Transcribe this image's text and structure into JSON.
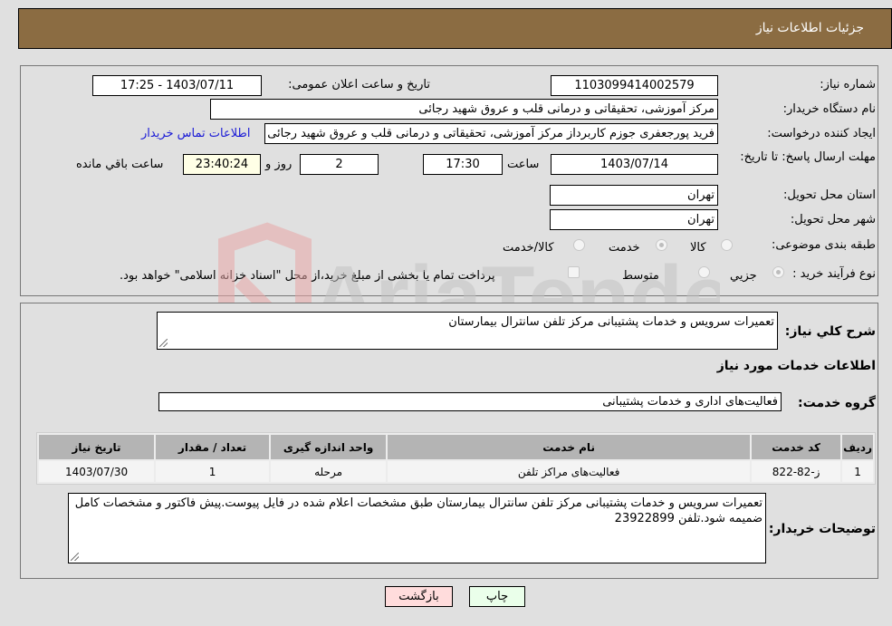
{
  "header": {
    "title": "جزئیات اطلاعات نیاز"
  },
  "fields": {
    "need_number": {
      "label": "شماره نیاز:",
      "value": "1103099414002579"
    },
    "announce_datetime": {
      "label": "تاریخ و ساعت اعلان عمومی:",
      "value": "1403/07/11 - 17:25"
    },
    "buyer_org": {
      "label": "نام دستگاه خریدار:",
      "value": "مرکز آموزشی، تحقیقاتی و درمانی قلب و عروق شهید رجائی"
    },
    "requester": {
      "label": "ایجاد کننده درخواست:",
      "value": "فرید پورجعفری جوزم کاربرداز  مرکز آموزشی، تحقیقاتی و درمانی قلب و عروق شهید رجائی",
      "contact_link": "اطلاعات تماس خریدار"
    },
    "deadline": {
      "label": "مهلت ارسال پاسخ: تا تاریخ:",
      "date": "1403/07/14",
      "time_label": "ساعت",
      "time": "17:30",
      "days": "2",
      "days_label": "روز و",
      "remaining": "23:40:24",
      "remaining_label": "ساعت باقي مانده"
    },
    "province": {
      "label": "استان محل تحویل:",
      "value": "تهران"
    },
    "city": {
      "label": "شهر محل تحویل:",
      "value": "تهران"
    },
    "category": {
      "label": "طبقه بندی موضوعی:",
      "options": [
        {
          "label": "کالا",
          "checked": false
        },
        {
          "label": "خدمت",
          "checked": true
        },
        {
          "label": "کالا/خدمت",
          "checked": false
        }
      ]
    },
    "purchase_type": {
      "label": "نوع فرآیند خرید :",
      "options": [
        {
          "label": "جزيي",
          "checked": true
        },
        {
          "label": "متوسط",
          "checked": false
        }
      ],
      "treasury_checkbox_label": "پرداخت تمام یا بخشی از مبلغ خرید،از محل \"اسناد خزانه اسلامی\" خواهد بود.",
      "treasury_checked": false
    }
  },
  "summary": {
    "label": "شرح کلي نیاز:",
    "value": "تعمیرات سرویس و خدمات پشتیبانی مرکز تلفن سانترال بیمارستان"
  },
  "services_section": {
    "title": "اطلاعات خدمات مورد نیاز",
    "group_label": "گروه خدمت:",
    "group_value": "فعالیت‌های اداری و خدمات پشتیبانی",
    "table": {
      "headers": [
        "ردیف",
        "کد خدمت",
        "نام خدمت",
        "واحد اندازه گیری",
        "تعداد / مقدار",
        "تاریخ نیاز"
      ],
      "rows": [
        [
          "1",
          "ز-82-822",
          "فعالیت‌های مراکز تلفن",
          "مرحله",
          "1",
          "1403/07/30"
        ]
      ]
    }
  },
  "buyer_notes": {
    "label": "توضیحات خریدار:",
    "value": "تعمیرات سرویس و خدمات پشتیبانی مرکز تلفن سانترال بیمارستان طبق مشخصات اعلام شده در فایل پیوست.پیش فاکتور و مشخصات کامل ضمیمه شود.تلفن 23922899"
  },
  "buttons": {
    "print": "چاپ",
    "back": "بازگشت"
  },
  "watermark": {
    "text": "AriaTender.neT"
  },
  "colors": {
    "header_bg": "#8b6c42",
    "print_bg": "#eaffea",
    "back_bg": "#ffdcdc",
    "link": "#1a1ad6"
  }
}
